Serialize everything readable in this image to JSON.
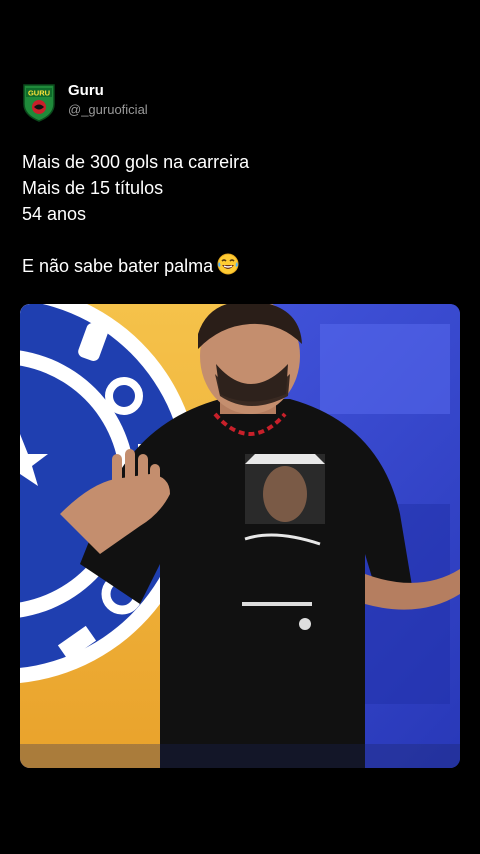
{
  "author": {
    "display_name": "Guru",
    "handle": "@_guruoficial",
    "avatar_icon": "guru-shield-logo",
    "avatar_text": "GURU"
  },
  "tweet": {
    "lines": [
      "Mais de 300 gols na carreira",
      "Mais de 15 títulos",
      "54 anos"
    ],
    "last_line": "E não sabe bater palma",
    "emoji_icon": "laughing-tears-emoji"
  },
  "media": {
    "type": "video-frame",
    "description_icon": "man-gesturing-image",
    "colors": {
      "background_left": "#f2b53a",
      "background_right": "#3c4fd8",
      "crest_blue": "#1f3fb0",
      "shirt": "#111111"
    }
  }
}
